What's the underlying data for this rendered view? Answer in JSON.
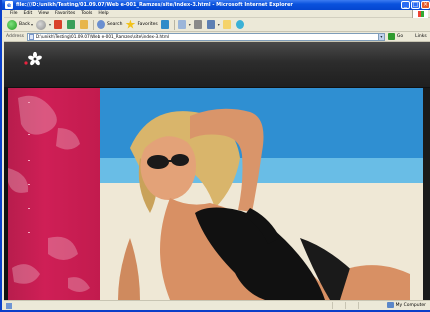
{
  "window": {
    "title": "file:///D:/unikh/Testing/01.09.07/Web e-001_Ramzes/site/index-3.html - Microsoft Internet Explorer",
    "controls": [
      "_",
      "□",
      "×"
    ]
  },
  "menu": [
    "File",
    "Edit",
    "View",
    "Favorites",
    "Tools",
    "Help"
  ],
  "toolbar": {
    "back_label": "Back",
    "search_label": "Search",
    "favorites_label": "Favorites"
  },
  "address": {
    "label": "Address",
    "url": "D:\\unikh\\Testing\\01.09.07\\Web e-001_Ramzes\\site\\index-3.html",
    "go_label": "Go",
    "links_label": "Links"
  },
  "status": {
    "text": "",
    "zone": "My Computer"
  },
  "colors": {
    "sidebar": "#cf1f56",
    "header": "#2c2c2c",
    "titlebar": "#0a52dd"
  },
  "icons": [
    "back-icon",
    "forward-icon",
    "stop-icon",
    "refresh-icon",
    "home-icon",
    "search-icon",
    "favorites-icon",
    "media-icon",
    "mail-icon",
    "print-icon",
    "edit-icon",
    "folder-icon",
    "messenger-icon"
  ]
}
